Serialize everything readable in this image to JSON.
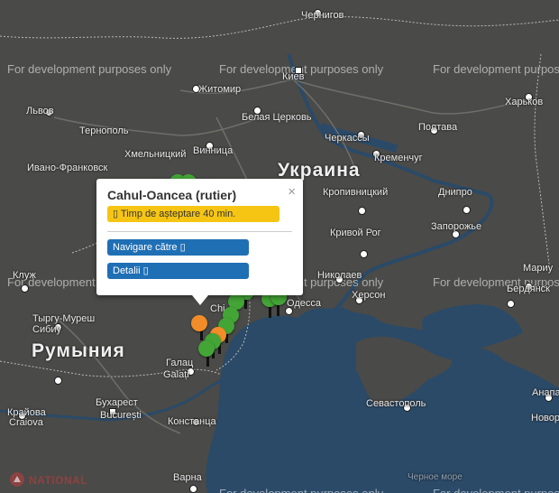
{
  "labels": {
    "countries": [
      {
        "id": "ukraine",
        "text": "Украина"
      },
      {
        "id": "romania",
        "text": "Румыния"
      }
    ],
    "cities": [
      {
        "id": "chernigov",
        "text": "Чернигов"
      },
      {
        "id": "kiev",
        "text": "Киев"
      },
      {
        "id": "zhitomir",
        "text": "Житомир"
      },
      {
        "id": "lvov",
        "text": "Львов"
      },
      {
        "id": "belaya-cerkov",
        "text": "Белая Церковь"
      },
      {
        "id": "kharkov",
        "text": "Харьков"
      },
      {
        "id": "ternopol",
        "text": "Тернополь"
      },
      {
        "id": "vinnica",
        "text": "Винница"
      },
      {
        "id": "cherkassy",
        "text": "Черкассы"
      },
      {
        "id": "poltava",
        "text": "Полтава"
      },
      {
        "id": "ivano-frankovsk",
        "text": "Ивано-Франковск"
      },
      {
        "id": "kremenchug",
        "text": "Кременчуг"
      },
      {
        "id": "khmelnitsky",
        "text": "Хмельницкий"
      },
      {
        "id": "kropivnitsky",
        "text": "Кропивницкий"
      },
      {
        "id": "dnipro",
        "text": "Днипро"
      },
      {
        "id": "krivoy-rog",
        "text": "Кривой Рог"
      },
      {
        "id": "zaporozhye",
        "text": "Запорожье"
      },
      {
        "id": "kluzh",
        "text": "Клуж"
      },
      {
        "id": "nikolaev",
        "text": "Николаев"
      },
      {
        "id": "mariu",
        "text": "Мариу"
      },
      {
        "id": "kherson",
        "text": "Херсон"
      },
      {
        "id": "berdyansk",
        "text": "Бердянск"
      },
      {
        "id": "odessa",
        "text": "Одесса"
      },
      {
        "id": "tyrgu-muresh",
        "text": "Тыргу-Муреш"
      },
      {
        "id": "sibiu",
        "text": "Сибиу"
      },
      {
        "id": "galati",
        "text": "Galați"
      },
      {
        "id": "galac",
        "text": "Галац"
      },
      {
        "id": "bucharest",
        "text": "Бухарест"
      },
      {
        "id": "bucuresti",
        "text": "București"
      },
      {
        "id": "craiova",
        "text": "Craiova"
      },
      {
        "id": "krayova",
        "text": "Крайова"
      },
      {
        "id": "constanta",
        "text": "Констанца"
      },
      {
        "id": "sevastopol",
        "text": "Севастополь"
      },
      {
        "id": "anapa",
        "text": "Анапа"
      },
      {
        "id": "novoross",
        "text": "Новор"
      },
      {
        "id": "varna",
        "text": "Варна"
      },
      {
        "id": "chi",
        "text": "Chi"
      },
      {
        "id": "cherepnoe-more",
        "text": "Черное море"
      }
    ]
  },
  "watermark": "For development purposes only",
  "popup": {
    "title": "Cahul-Oancea (rutier)",
    "close_icon": "×",
    "wait_icon": "▯",
    "wait_text": "Timp de așteptare 40 min.",
    "navigate_label": "Navigare către",
    "navigate_icon": "▯",
    "details_label": "Detalii",
    "details_icon": "▯"
  },
  "logo": {
    "text": "NATIONAL"
  },
  "colors": {
    "land": "#4a4a48",
    "sea": "#2a4a68",
    "marker_green": "#43a536",
    "marker_orange": "#f28c28",
    "wait_badge": "#f6c514",
    "button_blue": "#1f6fb5"
  }
}
